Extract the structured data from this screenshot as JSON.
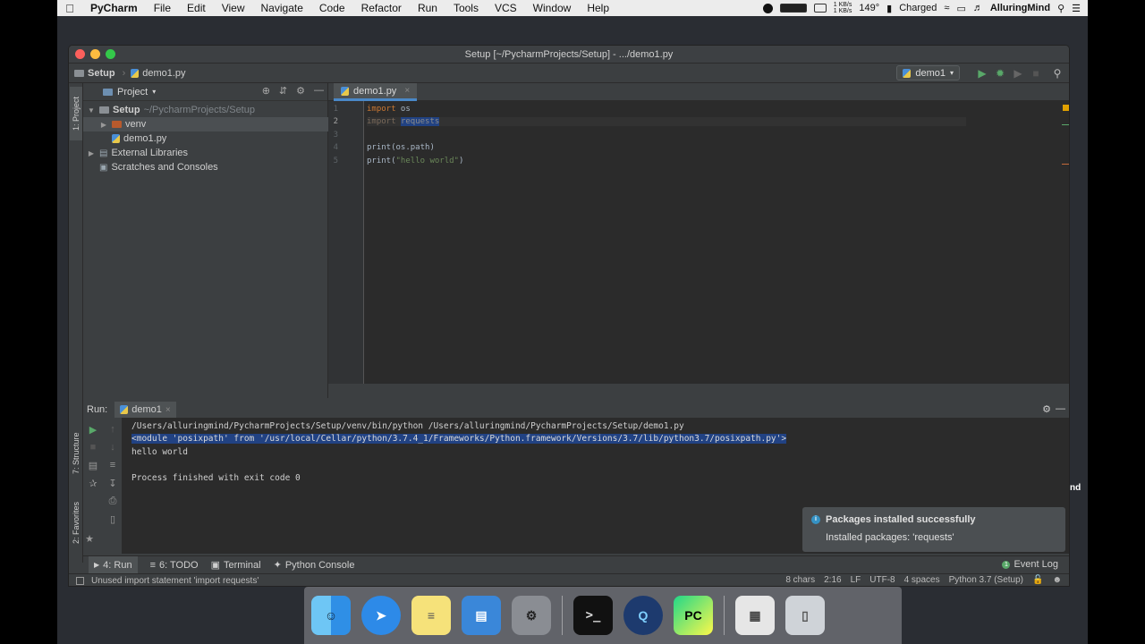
{
  "menubar": {
    "app": "PyCharm",
    "items": [
      "File",
      "Edit",
      "View",
      "Navigate",
      "Code",
      "Refactor",
      "Run",
      "Tools",
      "VCS",
      "Window",
      "Help"
    ],
    "net_up": "1 KB/s",
    "net_down": "1 KB/s",
    "temp": "149°",
    "battery": "Charged",
    "user": "AlluringMind"
  },
  "window": {
    "title": "Setup [~/PycharmProjects/Setup] - .../demo1.py",
    "breadcrumb": [
      "Setup",
      "demo1.py"
    ],
    "run_config": "demo1"
  },
  "sidebar": {
    "tab_project": "1: Project",
    "tab_structure": "7: Structure",
    "tab_favorites": "2: Favorites"
  },
  "project": {
    "header": "Project",
    "root": "Setup",
    "root_path": "~/PycharmProjects/Setup",
    "items": [
      "venv",
      "demo1.py",
      "External Libraries",
      "Scratches and Consoles"
    ]
  },
  "editor": {
    "tab": "demo1.py",
    "line_numbers": [
      "1",
      "2",
      "3",
      "4",
      "5"
    ],
    "lines": {
      "l1_kw": "import",
      "l1_rest": " os",
      "l2_kw": "import",
      "l2_rest": "requests",
      "l4": "print(os.path)",
      "l5_a": "print(",
      "l5_str": "\"hello world\"",
      "l5_b": ")"
    }
  },
  "run": {
    "label": "Run:",
    "tab": "demo1",
    "output": [
      "/Users/alluringmind/PycharmProjects/Setup/venv/bin/python /Users/alluringmind/PycharmProjects/Setup/demo1.py",
      "<module 'posixpath' from '/usr/local/Cellar/python/3.7.4_1/Frameworks/Python.framework/Versions/3.7/lib/python3.7/posixpath.py'>",
      "hello world",
      "",
      "Process finished with exit code 0"
    ]
  },
  "notification": {
    "title": "Packages installed successfully",
    "body": "Installed packages: 'requests'"
  },
  "bottom_tools": {
    "run": "4: Run",
    "todo": "6: TODO",
    "terminal": "Terminal",
    "console": "Python Console",
    "event_log": "Event Log"
  },
  "status": {
    "message": "Unused import statement 'import requests'",
    "chars": "8 chars",
    "position": "2:16",
    "line_sep": "LF",
    "encoding": "UTF-8",
    "indent": "4 spaces",
    "interpreter": "Python 3.7 (Setup)"
  },
  "desktop_edge_text": "nd",
  "colors": {
    "accent": "#4a88c7",
    "keyword": "#cc7832",
    "string": "#6a8759",
    "selection": "#214283",
    "run_green": "#59a869"
  }
}
